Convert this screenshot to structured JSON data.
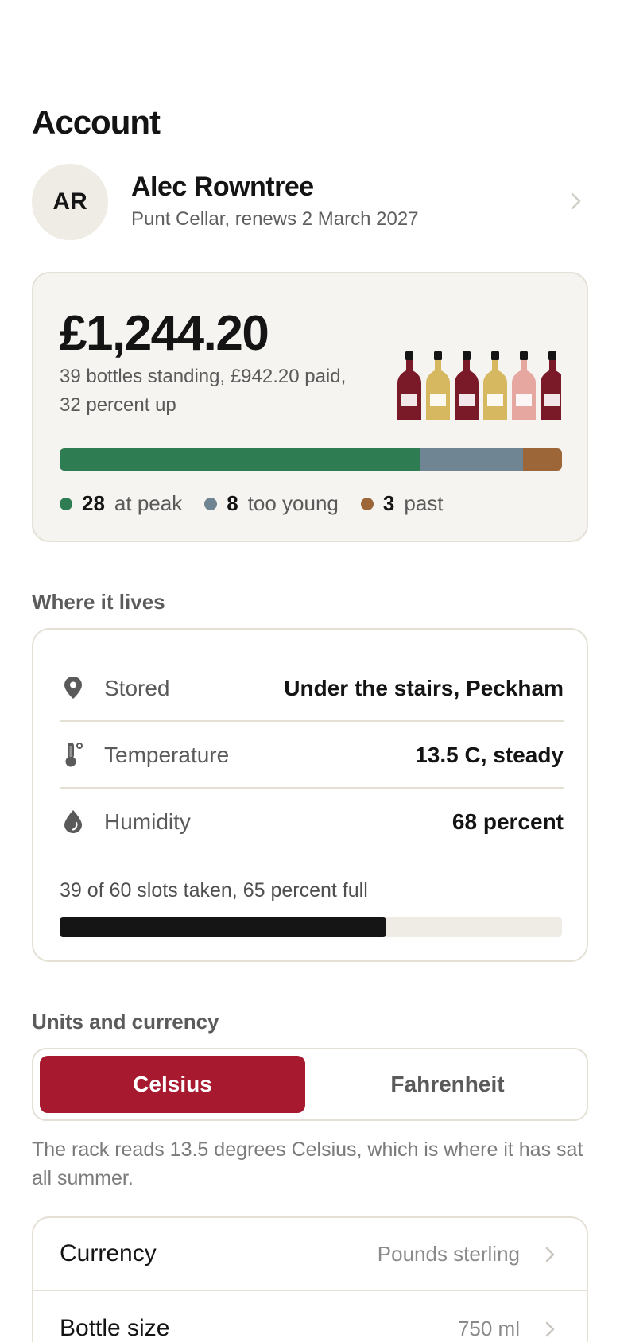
{
  "page": {
    "title": "Account"
  },
  "profile": {
    "initials": "AR",
    "name": "Alec Rowntree",
    "subtitle": "Punt Cellar, renews 2 March 2027"
  },
  "cellar_value": {
    "amount": "£1,244.20",
    "summary": "39 bottles standing, £942.20 paid, 32 percent up",
    "bottle_colors": [
      "#7a1a28",
      "#d6b860",
      "#7a1a28",
      "#d6b860",
      "#e6a7a0",
      "#7a1a28"
    ],
    "maturity": [
      {
        "count": "28",
        "label": "at peak",
        "value": 28,
        "color": "#2e7d52"
      },
      {
        "count": "8",
        "label": "too young",
        "value": 8,
        "color": "#6f8593"
      },
      {
        "count": "3",
        "label": "past",
        "value": 3,
        "color": "#9c6638"
      }
    ]
  },
  "where_it_lives": {
    "heading": "Where it lives",
    "rows": [
      {
        "icon": "location-pin-icon",
        "label": "Stored",
        "value": "Under the stairs, Peckham"
      },
      {
        "icon": "thermometer-icon",
        "label": "Temperature",
        "value": "13.5 C, steady"
      },
      {
        "icon": "droplet-icon",
        "label": "Humidity",
        "value": "68 percent"
      }
    ],
    "slots_text": "39 of 60 slots taken, 65 percent full",
    "slots_fraction": 0.65
  },
  "units": {
    "heading": "Units and currency",
    "options": [
      "Celsius",
      "Fahrenheit"
    ],
    "selected": "Celsius",
    "accent_color": "#a6192e",
    "note": "The rack reads 13.5 degrees Celsius, which is where it has sat all summer."
  },
  "settings_list": [
    {
      "label": "Currency",
      "value": "Pounds sterling"
    },
    {
      "label": "Bottle size",
      "value": "750 ml"
    }
  ]
}
